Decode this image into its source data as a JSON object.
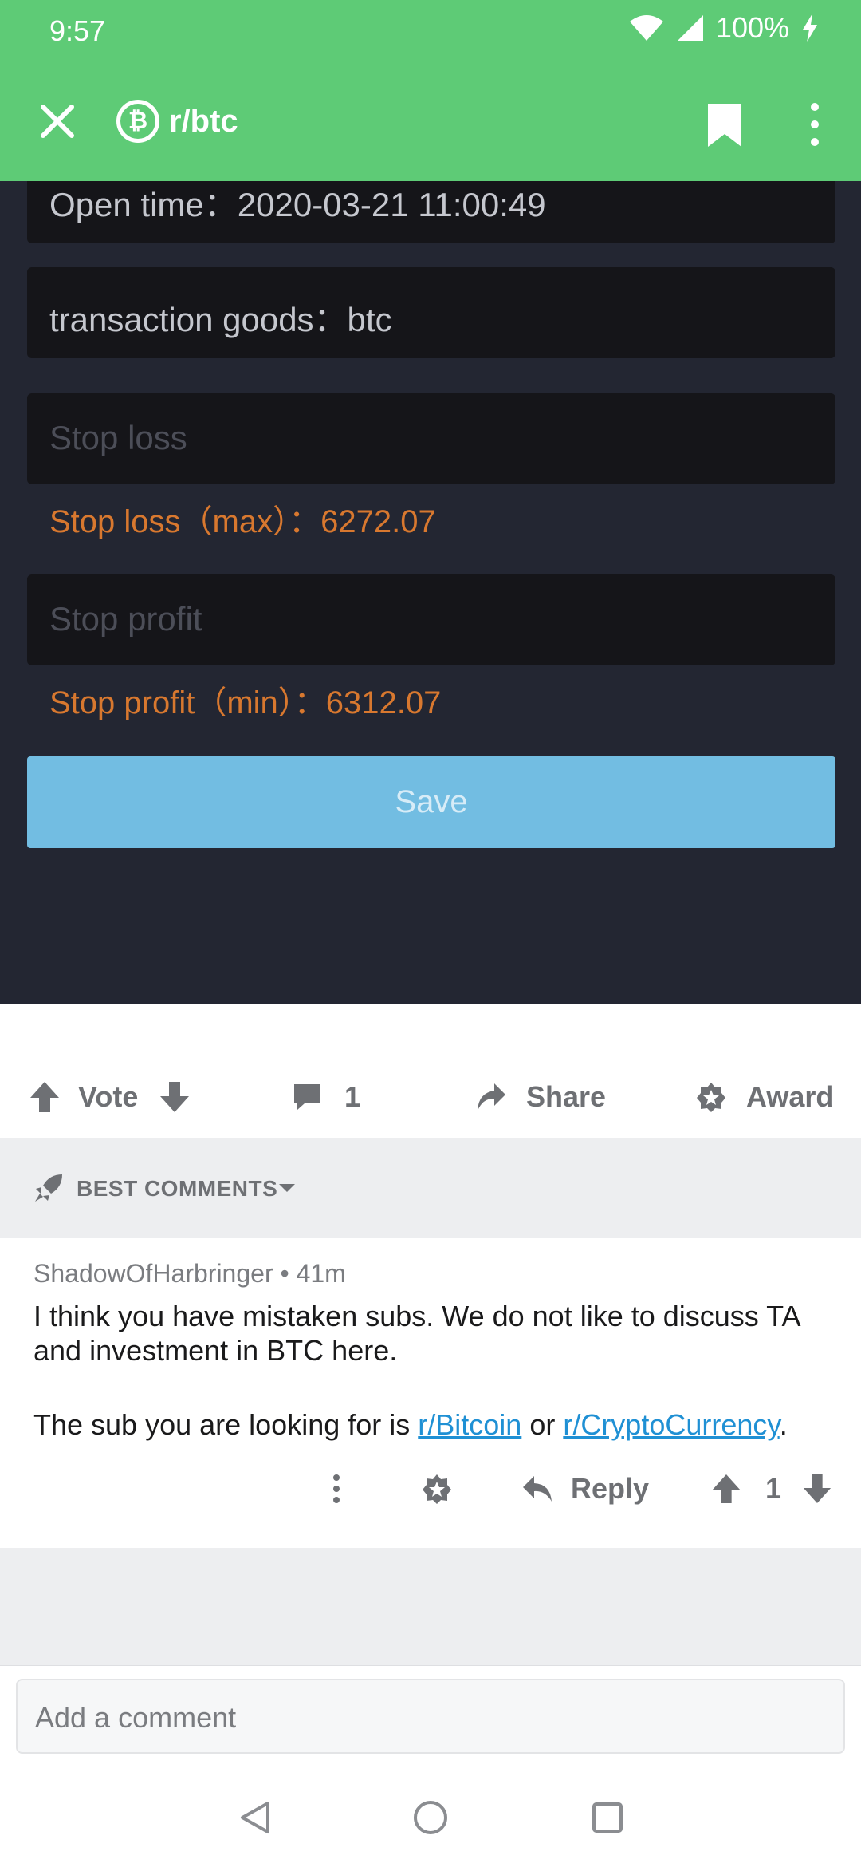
{
  "status_bar": {
    "time": "9:57",
    "battery": "100%"
  },
  "app_bar": {
    "subreddit": "r/btc",
    "subreddit_icon_letter": "₿"
  },
  "embedded_image": {
    "open_time": "Open time：2020-03-21 11:00:49",
    "transaction_goods": "transaction goods：btc",
    "stop_loss_placeholder": "Stop loss",
    "stop_loss_note": "Stop loss（max）：6272.07",
    "stop_profit_placeholder": "Stop profit",
    "stop_profit_note": "Stop profit（min）：6312.07",
    "save_label": "Save"
  },
  "post_actions": {
    "vote_label": "Vote",
    "comment_count": "1",
    "share_label": "Share",
    "award_label": "Award"
  },
  "sort": {
    "label": "BEST COMMENTS"
  },
  "comment": {
    "author": "ShadowOfHarbringer",
    "age": "41m",
    "meta": "ShadowOfHarbringer • 41m",
    "line1": "I think you have mistaken subs. We do not like to discuss TA and investment in BTC here.",
    "line2_prefix": "The sub you are looking for is ",
    "link1": "r/Bitcoin",
    "line2_mid": " or ",
    "link2": "r/CryptoCurrency",
    "line2_suffix": ".",
    "reply_label": "Reply",
    "score": "1"
  },
  "composer": {
    "placeholder": "Add a comment"
  },
  "colors": {
    "header_green": "#5ecb76",
    "dark_bg": "#232632",
    "accent_orange": "#d8782f",
    "save_blue": "#72bde2",
    "link_blue": "#1f90d4"
  },
  "icons": [
    "wifi-icon",
    "signal-icon",
    "battery-charging-icon",
    "close-icon",
    "bitcoin-icon",
    "bookmark-icon",
    "more-vertical-icon",
    "upvote-icon",
    "downvote-icon",
    "comment-icon",
    "share-icon",
    "award-icon",
    "rocket-icon",
    "caret-down-icon",
    "reply-icon",
    "back-nav-icon",
    "home-nav-icon",
    "recents-nav-icon"
  ]
}
